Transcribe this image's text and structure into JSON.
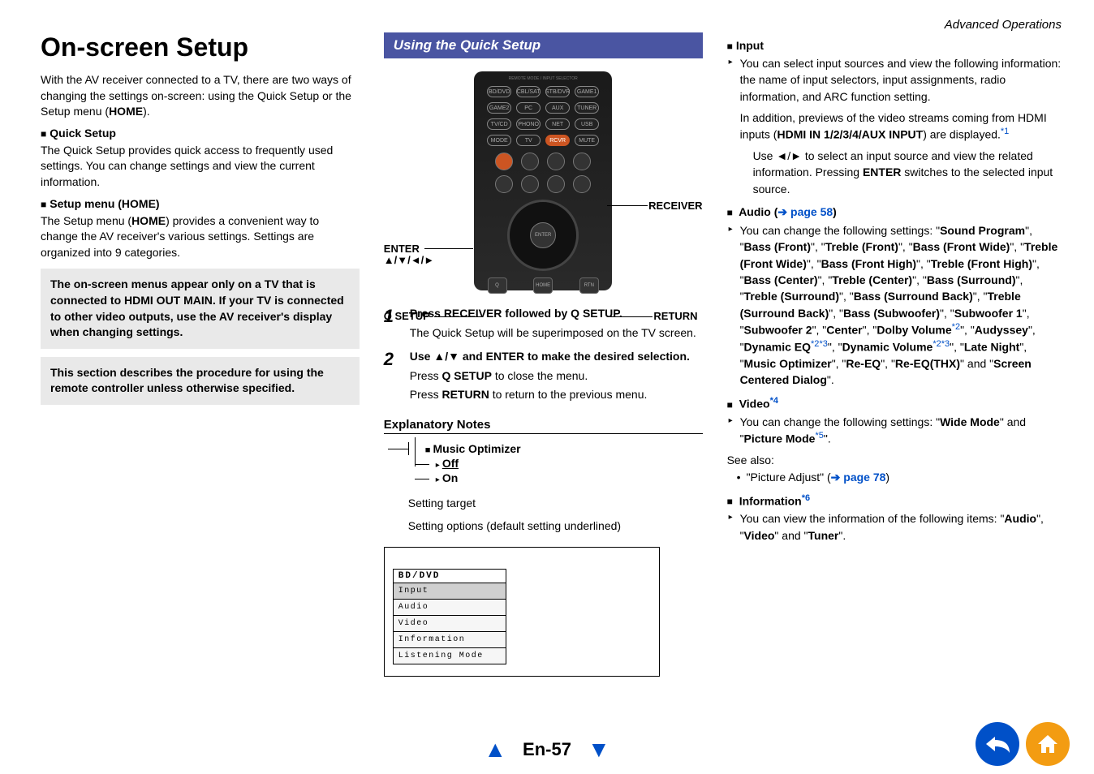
{
  "header": {
    "section": "Advanced Operations"
  },
  "col1": {
    "title": "On-screen Setup",
    "intro": "With the AV receiver connected to a TV, there are two ways of changing the settings on-screen: using the Quick Setup or the Setup menu (HOME).",
    "quickSetupTitle": "Quick Setup",
    "quickSetupBody": "The Quick Setup provides quick access to frequently used settings. You can change settings and view the current information.",
    "setupMenuTitle": "Setup menu (HOME)",
    "setupMenuBody": "The Setup menu (HOME) provides a convenient way to change the AV receiver's various settings. Settings are organized into 9 categories.",
    "callout1": "The on-screen menus appear only on a TV that is connected to HDMI OUT MAIN. If your TV is connected to other video outputs, use the AV receiver's display when changing settings.",
    "callout2": "This section describes the procedure for using the remote controller unless otherwise specified."
  },
  "col2": {
    "banner": "Using the Quick Setup",
    "labels": {
      "receiver": "RECEIVER",
      "enter": "ENTER",
      "arrows": "▲/▼/◄/►",
      "qsetup": "Q SETUP",
      "return": "RETURN"
    },
    "step1": "Press RECEIVER followed by Q SETUP.",
    "step1b": "The Quick Setup will be superimposed on the TV screen.",
    "step2": "Use ▲/▼ and ENTER to make the desired selection.",
    "step2b": "Press Q SETUP to close the menu.",
    "step2c": "Press RETURN to return to the previous menu.",
    "expTitle": "Explanatory Notes",
    "optHeader": "Music Optimizer",
    "optOff": "Off",
    "optOn": "On",
    "settingTarget": "Setting target",
    "settingOptions": "Setting options (default setting underlined)",
    "menu": {
      "header": "BD/DVD",
      "items": [
        "Input",
        "Audio",
        "Video",
        "Information",
        "Listening Mode"
      ]
    }
  },
  "col3": {
    "inputTitle": "Input",
    "inputBody1": "You can select input sources and view the following information: the name of input selectors, input assignments, radio information, and ARC function setting.",
    "inputBody2a": "In addition, previews of the video streams coming from HDMI inputs (",
    "inputBody2b": "HDMI IN 1/2/3/4/AUX INPUT",
    "inputBody2c": ") are displayed.",
    "inputBody3": "Use ◄/► to select an input source and view the related information. Pressing ENTER switches to the selected input source.",
    "audioTitleA": "Audio (",
    "audioTitleLink": "➔ page 58",
    "audioTitleB": ")",
    "audioBody": "You can change the following settings: \"Sound Program\", \"Bass (Front)\", \"Treble (Front)\", \"Bass (Front Wide)\", \"Treble (Front Wide)\", \"Bass (Front High)\", \"Treble (Front High)\", \"Bass (Center)\", \"Treble (Center)\", \"Bass (Surround)\", \"Treble (Surround)\", \"Bass (Surround Back)\", \"Treble (Surround Back)\", \"Bass (Subwoofer)\", \"Subwoofer 1\", \"Subwoofer 2\", \"Center\", \"Dolby Volume*2\", \"Audyssey\", \"Dynamic EQ*2*3\", \"Dynamic Volume*2*3\", \"Late Night\", \"Music Optimizer\", \"Re-EQ\", \"Re-EQ(THX)\" and \"Screen Centered Dialog\".",
    "videoTitle": "Video",
    "videoBody": "You can change the following settings: \"Wide Mode\" and \"Picture Mode*5\".",
    "seeAlso": "See also:",
    "seeAlsoItemA": "\"Picture Adjust\" (",
    "seeAlsoLink": "➔ page 78",
    "seeAlsoItemB": ")",
    "infoTitle": "Information",
    "infoBody": "You can view the information of the following items: \"Audio\", \"Video\" and \"Tuner\"."
  },
  "footer": {
    "page": "En-57"
  }
}
